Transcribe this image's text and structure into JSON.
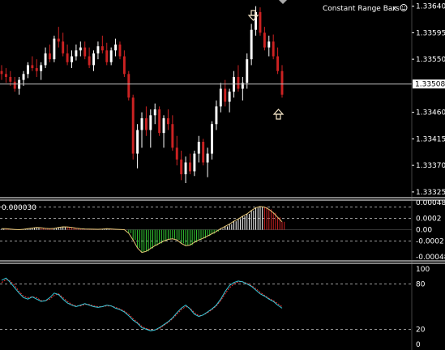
{
  "chart_data": {
    "type": "candlestick",
    "title": "Constant Range Bars",
    "title_suffix": "x",
    "colors": {
      "background": "#000000",
      "up_candle": "#ffffff",
      "down_candle": "#cc2222",
      "current_price_line": "#c0c0c0",
      "osc_up": "#ffffff",
      "osc_down": "#cc2222",
      "osc_neg": "#33cc33",
      "osc_curve": "#e8c878",
      "stoch_main": "#33ccdd",
      "stoch_signal": "#ee3333",
      "levels": "#cccccc",
      "pane_border": "#ffffff"
    },
    "main_pane": {
      "ylim": [
        1.33318,
        1.33645
      ],
      "yticks": [
        "1.33640",
        "1.33595",
        "1.33550",
        "1.33460",
        "1.33415",
        "1.33370",
        "1.33325"
      ],
      "current_price": "1.33508",
      "arrow_down_at": 1.33642,
      "arrow_up_at": 1.33455,
      "ohlc": [
        [
          1.3353,
          1.3354,
          1.33515,
          1.33525
        ],
        [
          1.33525,
          1.33535,
          1.3351,
          1.3352
        ],
        [
          1.3352,
          1.3353,
          1.33505,
          1.33512
        ],
        [
          1.33512,
          1.3352,
          1.33495,
          1.335
        ],
        [
          1.335,
          1.3352,
          1.3349,
          1.33515
        ],
        [
          1.33515,
          1.3353,
          1.33505,
          1.33525
        ],
        [
          1.33525,
          1.33545,
          1.33518,
          1.3354
        ],
        [
          1.3354,
          1.33555,
          1.3353,
          1.33535
        ],
        [
          1.33535,
          1.3355,
          1.3352,
          1.3353
        ],
        [
          1.3353,
          1.33545,
          1.33515,
          1.3354
        ],
        [
          1.3354,
          1.3357,
          1.33535,
          1.3356
        ],
        [
          1.3356,
          1.33575,
          1.33545,
          1.3355
        ],
        [
          1.3355,
          1.3359,
          1.33545,
          1.33585
        ],
        [
          1.33585,
          1.33605,
          1.3357,
          1.3358
        ],
        [
          1.3358,
          1.33595,
          1.33555,
          1.3356
        ],
        [
          1.3356,
          1.33575,
          1.3354,
          1.33545
        ],
        [
          1.33545,
          1.33565,
          1.33535,
          1.33555
        ],
        [
          1.33555,
          1.33575,
          1.33548,
          1.33565
        ],
        [
          1.33565,
          1.3358,
          1.33555,
          1.3357
        ],
        [
          1.3357,
          1.3358,
          1.3355,
          1.33555
        ],
        [
          1.33555,
          1.3357,
          1.33535,
          1.3354
        ],
        [
          1.3354,
          1.33565,
          1.3353,
          1.3356
        ],
        [
          1.3356,
          1.3358,
          1.3355,
          1.33572
        ],
        [
          1.33572,
          1.3359,
          1.3356,
          1.33565
        ],
        [
          1.33565,
          1.33578,
          1.3354,
          1.33545
        ],
        [
          1.33545,
          1.3357,
          1.3354,
          1.33565
        ],
        [
          1.33565,
          1.33585,
          1.33555,
          1.33575
        ],
        [
          1.33575,
          1.3358,
          1.3355,
          1.33555
        ],
        [
          1.33555,
          1.33565,
          1.3352,
          1.33525
        ],
        [
          1.33525,
          1.3353,
          1.3348,
          1.33485
        ],
        [
          1.33485,
          1.3349,
          1.3338,
          1.3339
        ],
        [
          1.3339,
          1.3344,
          1.33365,
          1.3343
        ],
        [
          1.3343,
          1.3346,
          1.334,
          1.3345
        ],
        [
          1.3345,
          1.3347,
          1.3342,
          1.3343
        ],
        [
          1.3343,
          1.33465,
          1.334,
          1.33455
        ],
        [
          1.33455,
          1.33475,
          1.3344,
          1.33465
        ],
        [
          1.33465,
          1.3347,
          1.3342,
          1.33425
        ],
        [
          1.33425,
          1.33455,
          1.334,
          1.3345
        ],
        [
          1.3345,
          1.33465,
          1.3343,
          1.3344
        ],
        [
          1.3344,
          1.33455,
          1.33395,
          1.334
        ],
        [
          1.334,
          1.3342,
          1.3337,
          1.3338
        ],
        [
          1.3338,
          1.33395,
          1.33345,
          1.33355
        ],
        [
          1.33355,
          1.33385,
          1.3334,
          1.33375
        ],
        [
          1.33375,
          1.3339,
          1.33355,
          1.3336
        ],
        [
          1.3336,
          1.33395,
          1.33352,
          1.3339
        ],
        [
          1.3339,
          1.3342,
          1.33375,
          1.3341
        ],
        [
          1.3341,
          1.33415,
          1.3337,
          1.33375
        ],
        [
          1.33375,
          1.334,
          1.3335,
          1.3339
        ],
        [
          1.3339,
          1.33445,
          1.3338,
          1.3344
        ],
        [
          1.3344,
          1.3348,
          1.3343,
          1.3347
        ],
        [
          1.3347,
          1.3351,
          1.3346,
          1.335
        ],
        [
          1.335,
          1.33515,
          1.3347,
          1.33478
        ],
        [
          1.33478,
          1.335,
          1.3346,
          1.33495
        ],
        [
          1.33495,
          1.3353,
          1.33485,
          1.3352
        ],
        [
          1.3352,
          1.3354,
          1.33495,
          1.335
        ],
        [
          1.335,
          1.3352,
          1.3348,
          1.3351
        ],
        [
          1.3351,
          1.3356,
          1.335,
          1.3355
        ],
        [
          1.3355,
          1.3361,
          1.3354,
          1.336
        ],
        [
          1.336,
          1.3364,
          1.3359,
          1.3363
        ],
        [
          1.3363,
          1.33638,
          1.3359,
          1.33595
        ],
        [
          1.33595,
          1.33605,
          1.33565,
          1.3357
        ],
        [
          1.3357,
          1.3359,
          1.33555,
          1.3358
        ],
        [
          1.3358,
          1.33592,
          1.3355,
          1.33555
        ],
        [
          1.33555,
          1.3357,
          1.33525,
          1.3353
        ],
        [
          1.3353,
          1.3354,
          1.33485,
          1.3349
        ]
      ]
    },
    "osc_pane": {
      "ylim": [
        -0.00052,
        0.00048
      ],
      "yticks": [
        "0.00048",
        "0.0002",
        "0.00",
        "-0.0002",
        "-0.00048"
      ],
      "levels": [
        0.0004,
        0.0002,
        -0.0002
      ],
      "corner_value": "0.000030",
      "values": [
        2e-05,
        1.8e-05,
        1.2e-05,
        6e-06,
        2e-06,
        8e-06,
        2e-05,
        3e-05,
        4e-05,
        3.5e-05,
        2.5e-05,
        1.8e-05,
        2.5e-05,
        4e-05,
        5.2e-05,
        5e-05,
        4e-05,
        2.8e-05,
        2e-05,
        1.5e-05,
        1.2e-05,
        1e-05,
        8e-06,
        1.2e-05,
        1.8e-05,
        1.5e-05,
        8e-06,
        4e-06,
        2e-06,
        -6e-05,
        -0.00018,
        -0.00032,
        -0.0004,
        -0.00038,
        -0.00033,
        -0.00028,
        -0.00024,
        -0.0002,
        -0.00017,
        -0.00016,
        -0.00018,
        -0.00024,
        -0.00028,
        -0.00027,
        -0.00022,
        -0.00018,
        -0.00015,
        -0.00011,
        -7e-05,
        -3e-05,
        2e-05,
        6e-05,
        0.0001,
        0.00015,
        0.00019,
        0.00024,
        0.00028,
        0.00034,
        0.00039,
        0.00041,
        0.0004,
        0.00036,
        0.0003,
        0.00022,
        0.00014
      ]
    },
    "stoch_pane": {
      "ylim": [
        0,
        100
      ],
      "yticks": [
        "100",
        "80",
        "20",
        "0"
      ],
      "levels": [
        80,
        20
      ],
      "main": [
        85,
        88,
        82,
        75,
        68,
        62,
        60,
        63,
        60,
        57,
        58,
        62,
        68,
        66,
        60,
        55,
        52,
        50,
        52,
        54,
        52,
        50,
        49,
        50,
        52,
        51,
        48,
        46,
        43,
        38,
        32,
        28,
        22,
        20,
        18,
        19,
        22,
        26,
        30,
        35,
        42,
        48,
        52,
        47,
        40,
        37,
        39,
        43,
        47,
        52,
        60,
        70,
        78,
        82,
        84,
        83,
        80,
        77,
        72,
        67,
        64,
        60,
        57,
        52,
        48
      ],
      "signal": [
        82,
        86,
        84,
        78,
        70,
        64,
        62,
        63,
        62,
        58,
        58,
        60,
        65,
        67,
        62,
        57,
        53,
        51,
        51,
        53,
        53,
        51,
        50,
        50,
        51,
        51,
        49,
        47,
        44,
        40,
        34,
        29,
        24,
        21,
        19,
        19,
        21,
        25,
        29,
        34,
        40,
        46,
        50,
        48,
        42,
        38,
        39,
        42,
        46,
        51,
        58,
        67,
        75,
        80,
        83,
        83,
        81,
        78,
        74,
        69,
        65,
        61,
        58,
        54,
        50
      ]
    }
  }
}
